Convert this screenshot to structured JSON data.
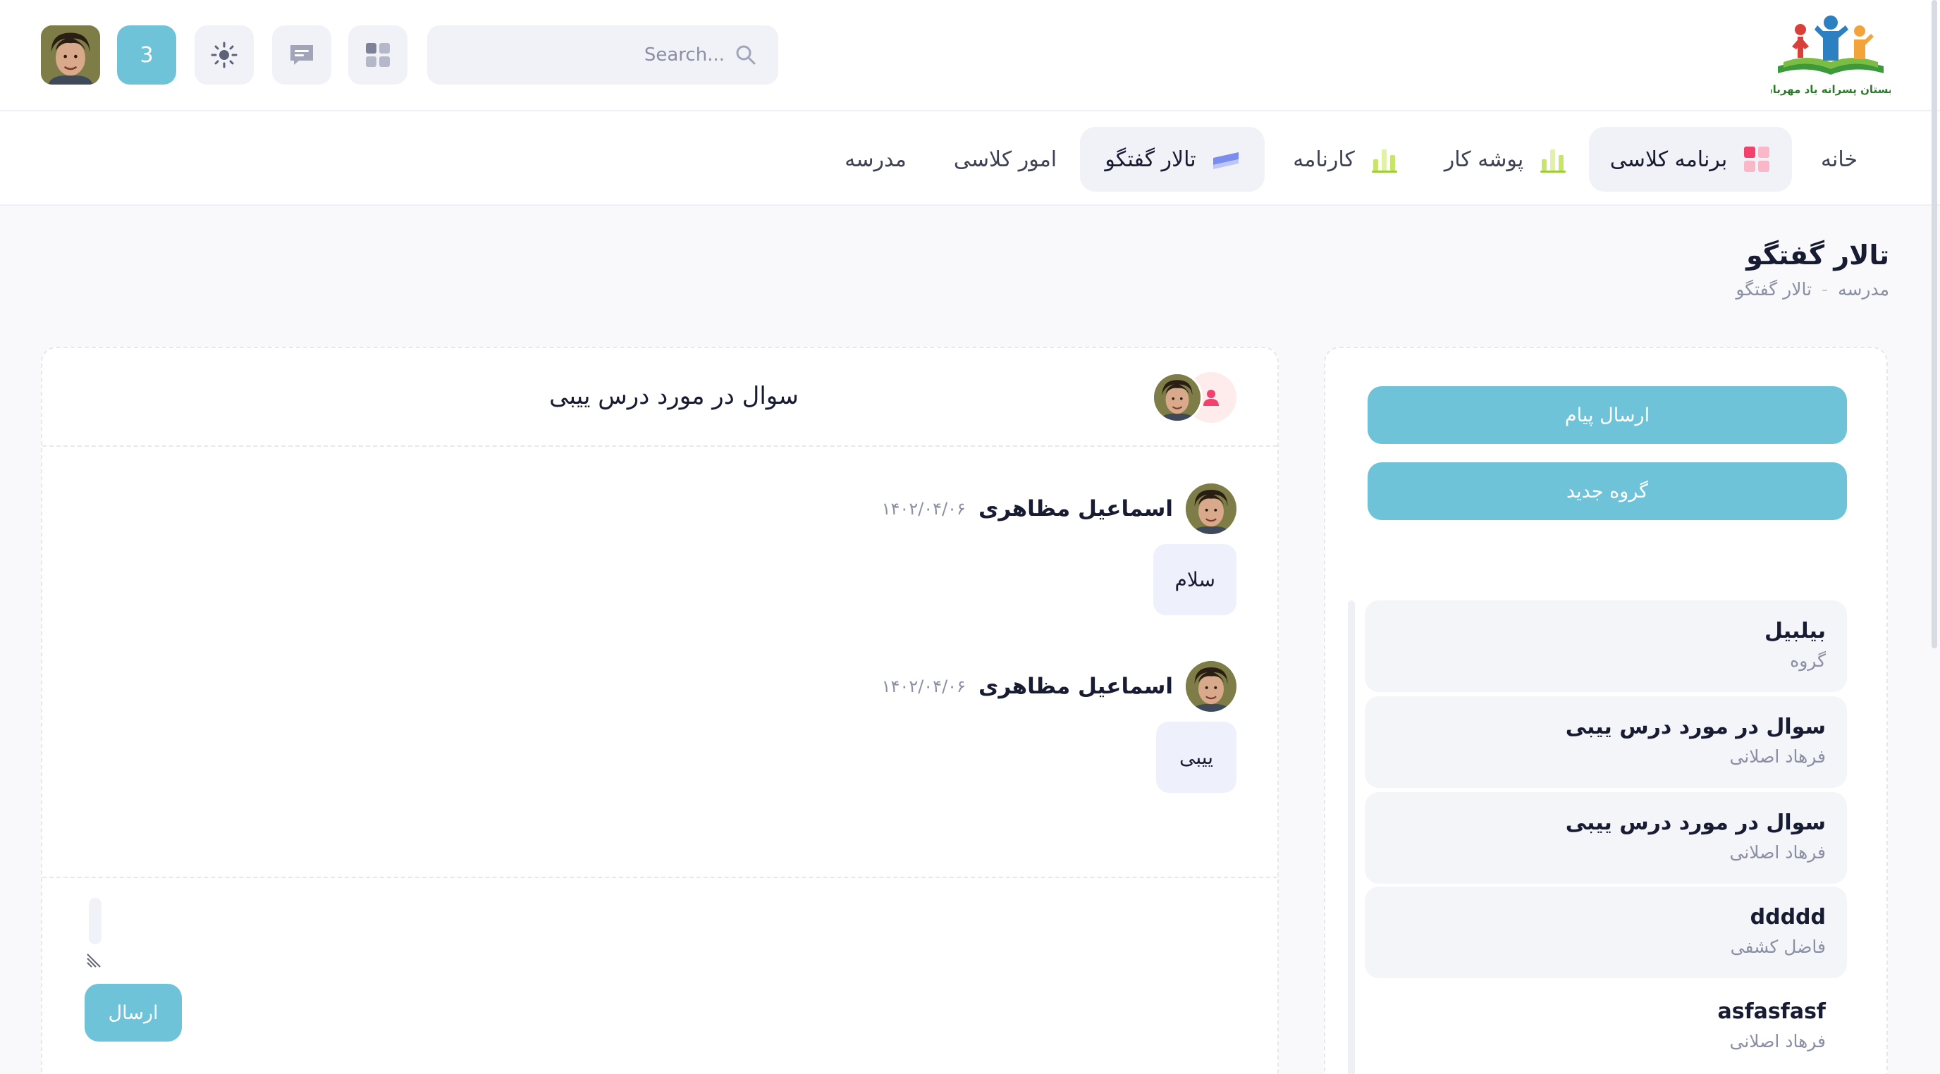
{
  "header": {
    "search_placeholder": "Search...",
    "notification_count": "3",
    "logo_text": "دبستان پسرانه یاد مهربان"
  },
  "nav": {
    "items": [
      {
        "label": "خانه",
        "icon": ""
      },
      {
        "label": "برنامه کلاسی",
        "icon": "grid-icon"
      },
      {
        "label": "پوشه کار",
        "icon": "bar-chart-icon"
      },
      {
        "label": "کارنامه",
        "icon": "bar-chart-icon"
      },
      {
        "label": "تالار گفتگو",
        "icon": "layers-icon"
      },
      {
        "label": "امور کلاسی",
        "icon": ""
      },
      {
        "label": "مدرسه",
        "icon": ""
      }
    ],
    "active": "تالار گفتگو"
  },
  "page": {
    "title": "تالار گفتگو",
    "breadcrumb": [
      "مدرسه",
      "-",
      "تالار گفتگو"
    ]
  },
  "conversations": {
    "send_message_label": "ارسال پیام",
    "new_group_label": "گروه جدید",
    "items": [
      {
        "title": "بیلبیل",
        "subtitle": "گروه"
      },
      {
        "title": "سوال در مورد درس ییبی",
        "subtitle": "فرهاد اصلانی"
      },
      {
        "title": "سوال در مورد درس ییبی",
        "subtitle": "فرهاد اصلانی"
      },
      {
        "title": "ddddd",
        "subtitle": "فاضل کشفی"
      },
      {
        "title": "asfasfasf",
        "subtitle": "فرهاد اصلانی"
      }
    ]
  },
  "chat": {
    "title": "سوال در مورد درس ییبی",
    "messages": [
      {
        "author": "اسماعیل مظاهری",
        "date": "۱۴۰۲/۰۴/۰۶",
        "text": "سلام"
      },
      {
        "author": "اسماعیل مظاهری",
        "date": "۱۴۰۲/۰۴/۰۶",
        "text": "ییبی"
      }
    ],
    "send_label": "ارسال"
  },
  "colors": {
    "accent": "#6fc3d8",
    "bubble": "#eef0fc",
    "panel_bg": "#f9f9fc"
  }
}
